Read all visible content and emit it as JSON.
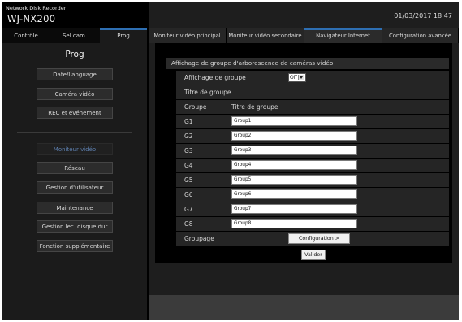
{
  "header": {
    "brand_small": "Network Disk Recorder",
    "model": "WJ-NX200",
    "datetime": "01/03/2017 18:47"
  },
  "left_tabs": [
    "Contrôle",
    "Sel cam.",
    "Prog"
  ],
  "left": {
    "title": "Prog",
    "menu": [
      "Date/Language",
      "Caméra vidéo",
      "REC et événement",
      "Moniteur vidéo",
      "Réseau",
      "Gestion d'utilisateur",
      "Maintenance",
      "Gestion lec. disque dur",
      "Fonction supplémentaire"
    ]
  },
  "right_tabs": [
    "Moniteur vidéo principal",
    "Moniteur vidéo secondaire",
    "Navigateur Internet",
    "Configuration avancée"
  ],
  "panel": {
    "section_title": "Affichage de groupe d'arborescence de caméras vidéo",
    "group_display_label": "Affichage de groupe",
    "group_display_value": "Off",
    "group_title_label": "Titre de groupe",
    "col_group": "Groupe",
    "col_title": "Titre de groupe",
    "groups": [
      {
        "id": "G1",
        "title": "Group1"
      },
      {
        "id": "G2",
        "title": "Group2"
      },
      {
        "id": "G3",
        "title": "Group3"
      },
      {
        "id": "G4",
        "title": "Group4"
      },
      {
        "id": "G5",
        "title": "Group5"
      },
      {
        "id": "G6",
        "title": "Group6"
      },
      {
        "id": "G7",
        "title": "Group7"
      },
      {
        "id": "G8",
        "title": "Group8"
      }
    ],
    "grouping_label": "Groupage",
    "config_button": "Configuration >",
    "validate_button": "Valider"
  }
}
